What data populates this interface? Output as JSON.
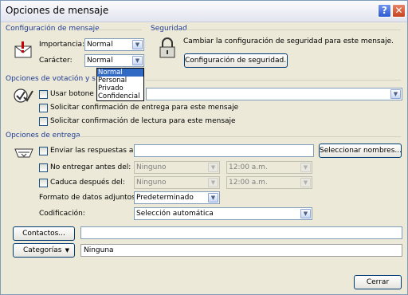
{
  "window": {
    "title": "Opciones de mensaje"
  },
  "config": {
    "group_label": "Configuración de mensaje",
    "importance_label": "Importancia:",
    "importance_value": "Normal",
    "character_label": "Carácter:",
    "character_value": "Normal",
    "character_options": [
      "Normal",
      "Personal",
      "Privado",
      "Confidencial"
    ]
  },
  "security": {
    "group_label": "Seguridad",
    "description": "Cambiar la configuración de seguridad para este mensaje.",
    "button_label": "Configuración de seguridad..."
  },
  "voting": {
    "group_label": "Opciones de votación y s",
    "use_buttons_label": "Usar botone",
    "delivery_receipt_label": "Solicitar confirmación de entrega para este mensaje",
    "read_receipt_label": "Solicitar confirmación de lectura para este mensaje"
  },
  "delivery": {
    "group_label": "Opciones de entrega",
    "send_replies_label": "Enviar las respuestas a:",
    "select_names_button": "Seleccionar nombres...",
    "not_before_label": "No entregar antes del:",
    "not_before_date": "Ninguno",
    "not_before_time": "12:00 a.m.",
    "expires_label": "Caduca después del:",
    "expires_date": "Ninguno",
    "expires_time": "12:00 a.m.",
    "attachment_format_label": "Formato de datos adjuntos:",
    "attachment_format_value": "Predeterminado",
    "encoding_label": "Codificación:",
    "encoding_value": "Selección automática"
  },
  "contacts": {
    "button_label": "Contactos..."
  },
  "categories": {
    "button_label": "Categorías",
    "value": "Ninguna"
  },
  "footer": {
    "close_button": "Cerrar"
  },
  "icons": {
    "help": "help-icon",
    "close": "close-icon",
    "importance": "envelope-importance-icon",
    "security": "padlock-icon",
    "voting": "voting-checkmarks-icon",
    "delivery": "delivery-tray-icon",
    "dropdown_arrow": "chevron-down-icon"
  }
}
